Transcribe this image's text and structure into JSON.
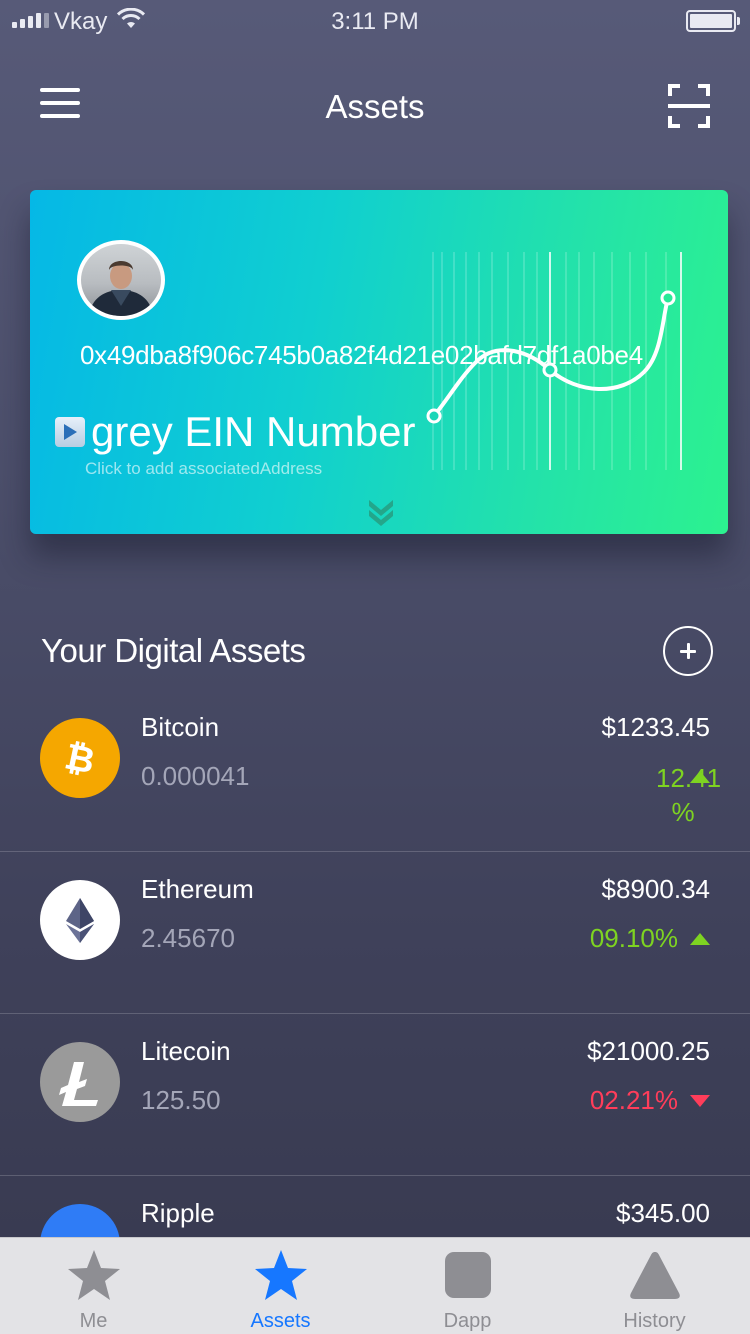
{
  "status_bar": {
    "carrier": "Vkay",
    "time": "3:11 PM"
  },
  "header": {
    "title": "Assets",
    "menu_icon": "hamburger-menu-icon",
    "scan_icon": "scan-frame-icon"
  },
  "card": {
    "address": "0x49dba8f906c745b0a82f4d21e02bafd7df1a0be4",
    "ein_label": "grey EIN Number",
    "associated_hint": "Click to add associatedAddress",
    "expand_icon": "double-chevron-down-icon",
    "gradient_colors": [
      "#05b8e6",
      "#2cf28f"
    ]
  },
  "assets_section": {
    "title": "Your Digital Assets",
    "add_icon": "plus-circle-icon"
  },
  "assets": [
    {
      "name": "Bitcoin",
      "amount": "0.000041",
      "price": "$1233.45",
      "change": "12.41 %",
      "direction": "up",
      "icon": "bitcoin-icon",
      "color": "#f5a700"
    },
    {
      "name": "Ethereum",
      "amount": "2.45670",
      "price": "$8900.34",
      "change": "09.10%",
      "direction": "up",
      "icon": "ethereum-icon",
      "color": "#ffffff"
    },
    {
      "name": "Litecoin",
      "amount": "125.50",
      "price": "$21000.25",
      "change": "02.21%",
      "direction": "down",
      "icon": "litecoin-icon",
      "color": "#9a9a9a"
    },
    {
      "name": "Ripple",
      "amount": "",
      "price": "$345.00",
      "change": "",
      "direction": "",
      "icon": "ripple-icon",
      "color": "#2f7cf6"
    }
  ],
  "colors": {
    "positive": "#7ed321",
    "negative": "#ff3d5a",
    "tab_active": "#1677ff",
    "tab_inactive": "#8e8e93"
  },
  "tabs": [
    {
      "label": "Me",
      "icon": "star-icon",
      "active": false
    },
    {
      "label": "Assets",
      "icon": "star-icon",
      "active": true
    },
    {
      "label": "Dapp",
      "icon": "rounded-square-icon",
      "active": false
    },
    {
      "label": "History",
      "icon": "triangle-icon",
      "active": false
    }
  ]
}
